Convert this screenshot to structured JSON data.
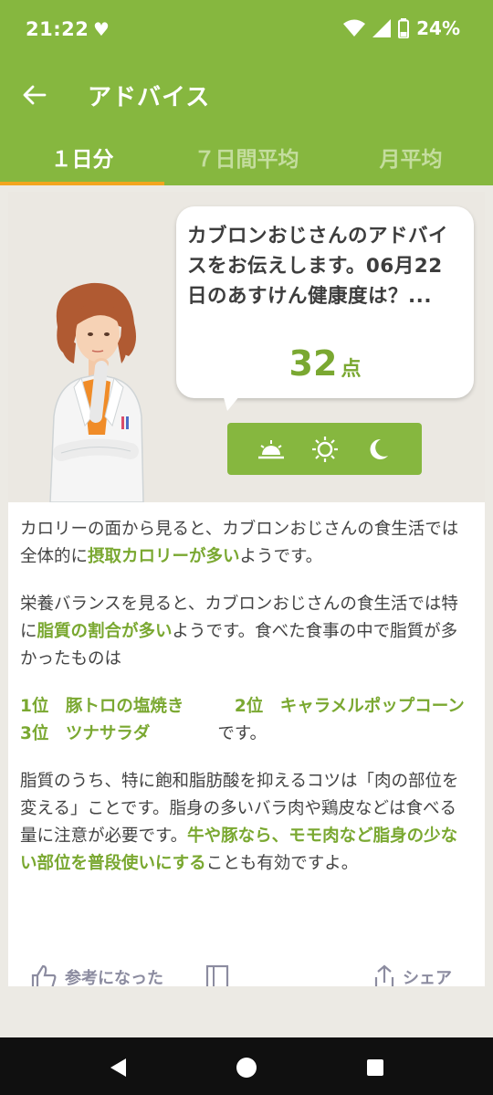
{
  "status": {
    "time": "21:22",
    "battery": "24%"
  },
  "appbar": {
    "title": "アドバイス"
  },
  "tabs": [
    {
      "label": "１日分",
      "active": true
    },
    {
      "label": "７日間平均",
      "active": false
    },
    {
      "label": "月平均",
      "active": false
    }
  ],
  "advice": {
    "bubble_text": "カブロンおじさんのアドバイスをお伝えします。06月22日のあすけん健康度は？...",
    "score": "32",
    "score_unit": "点",
    "p1": {
      "t1": "カロリーの面から見ると、カブロンおじさんの食生活では全体的に",
      "hl": "摂取カロリーが多い",
      "t2": "ようです。"
    },
    "p2": {
      "t1": "栄養バランスを見ると、カブロンおじさんの食生活では特に",
      "hl": "脂質の割合が多い",
      "t2": "ようです。食べた食事の中で脂質が多かったものは"
    },
    "ranks": {
      "r1": "1位　豚トロの塩焼き",
      "r2": "2位　キャラメルポップコーン",
      "r3": "3位　ツナサラダ",
      "suffix": "です。"
    },
    "p3": {
      "t1": "脂質のうち、特に飽和脂肪酸を抑えるコツは「肉の部位を変える」ことです。脂身の多いバラ肉や鶏皮などは食べる量に注意が必要です。",
      "hl": "牛や豚なら、モモ肉など脂身の少ない部位を普段使いにする",
      "t2": "ことも有効ですよ。"
    }
  },
  "actions": {
    "helpful": "参考になった",
    "share": "シェア"
  },
  "colors": {
    "primary": "#86b73f",
    "accent": "#f2a51f",
    "highlight": "#7aa831"
  }
}
